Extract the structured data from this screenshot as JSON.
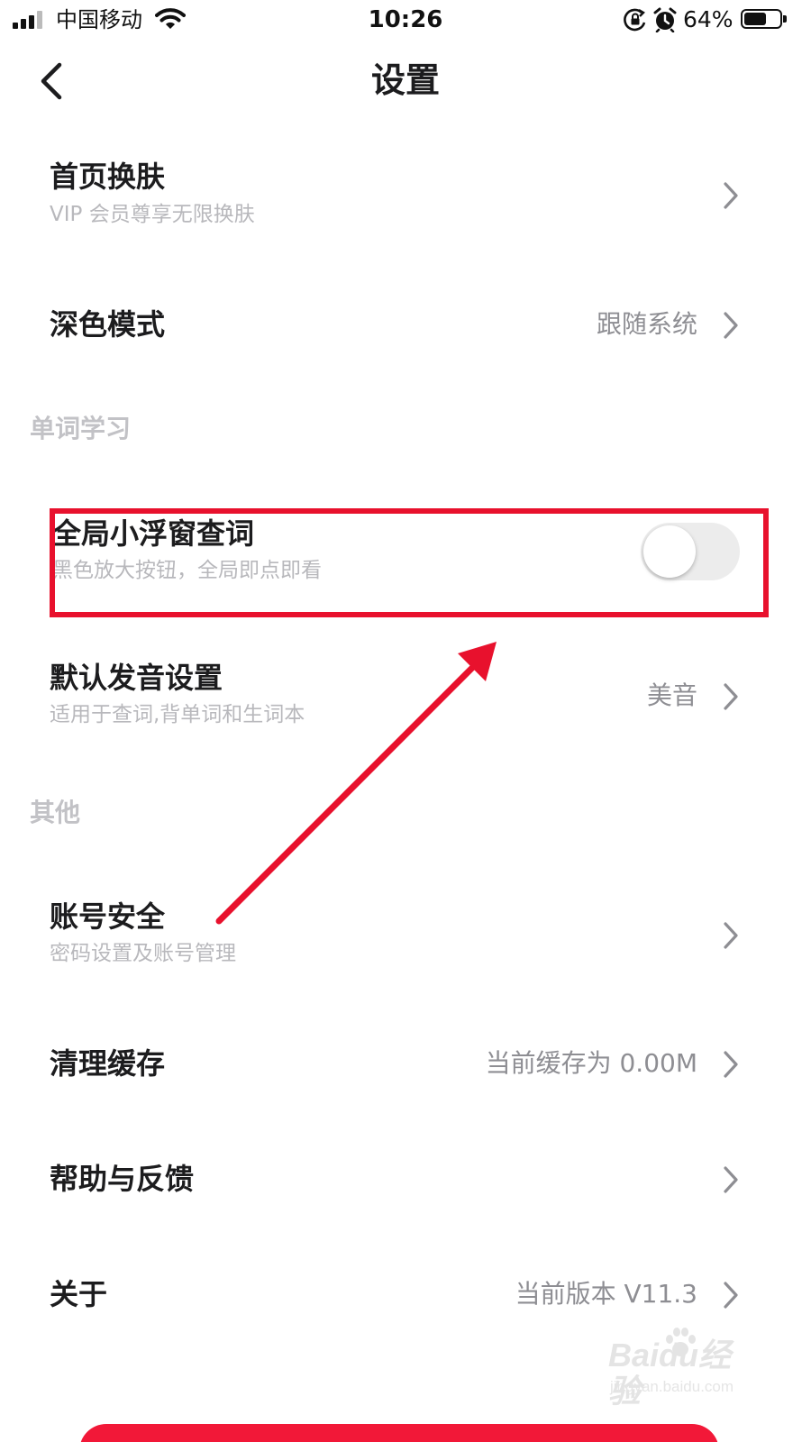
{
  "status_bar": {
    "carrier": "中国移动",
    "time": "10:26",
    "battery_percent": "64%",
    "battery_level": 0.64,
    "icons": [
      "signal-icon",
      "wifi-icon",
      "rotation-lock-icon",
      "alarm-icon",
      "battery-icon"
    ]
  },
  "nav": {
    "title": "设置",
    "back_icon": "chevron-left-icon"
  },
  "rows": {
    "skin": {
      "title": "首页换肤",
      "subtitle": "VIP 会员尊享无限换肤"
    },
    "dark_mode": {
      "title": "深色模式",
      "value": "跟随系统"
    },
    "floating_lookup": {
      "title": "全局小浮窗查词",
      "subtitle": "黑色放大按钮，全局即点即看",
      "enabled": false
    },
    "pronunciation": {
      "title": "默认发音设置",
      "subtitle": "适用于查词,背单词和生词本",
      "value": "美音"
    },
    "account": {
      "title": "账号安全",
      "subtitle": "密码设置及账号管理"
    },
    "cache": {
      "title": "清理缓存",
      "value": "当前缓存为 0.00M"
    },
    "help": {
      "title": "帮助与反馈"
    },
    "about": {
      "title": "关于",
      "value": "当前版本 V11.3"
    }
  },
  "sections": {
    "word_study": "单词学习",
    "other": "其他"
  },
  "annotation": {
    "color": "#e8112d"
  },
  "watermark": {
    "logo": "Baidu经验",
    "url": "jingyan.baidu.com"
  },
  "colors": {
    "accent": "#f21838",
    "text_primary": "#1c1c1e",
    "text_secondary": "#b8b8bc",
    "value_text": "#8e8e93"
  }
}
